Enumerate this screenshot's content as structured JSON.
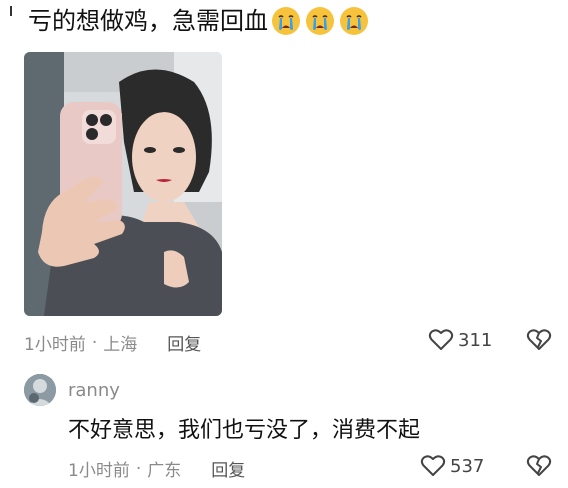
{
  "comment": {
    "text": "亏的想做鸡，急需回血",
    "emoji_icons": [
      "crying-face-icon",
      "crying-face-icon",
      "crying-face-icon"
    ],
    "time": "1小时前",
    "location": "上海",
    "reply_label": "回复",
    "likes": "311"
  },
  "reply": {
    "username": "ranny",
    "text": "不好意思，我们也亏没了，消费不起",
    "time": "1小时前",
    "location": "广东",
    "reply_label": "回复",
    "likes": "537"
  },
  "icons": {
    "like": "heart-outline-icon",
    "dislike": "broken-heart-icon"
  },
  "colors": {
    "meta_gray": "#8a8a8a",
    "text": "#111111",
    "emoji_yellow": "#f7c33c",
    "emoji_tear": "#3aa0e8"
  }
}
